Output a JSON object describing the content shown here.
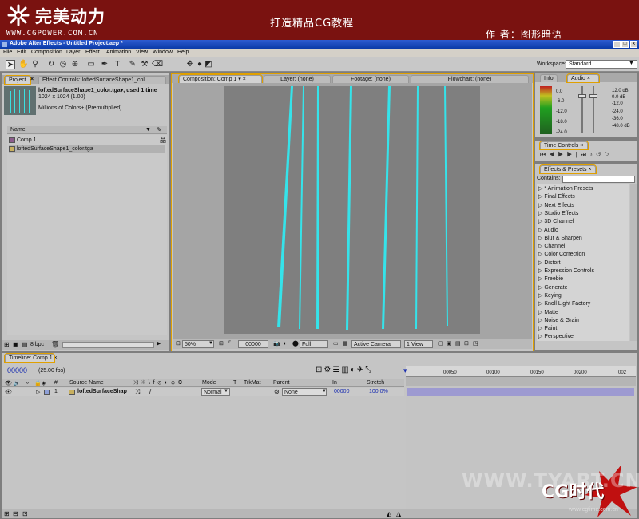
{
  "banner": {
    "logo_text": "完美动力",
    "site_url": "WWW.CGPOWER.COM.CN",
    "title": "打造精品CG教程",
    "author": "作 者：图形暗语",
    "color": "#7a1210"
  },
  "window": {
    "title": "Adobe After Effects - Untitled Project.aep *",
    "buttons": [
      "_",
      "□",
      "x"
    ]
  },
  "menu": [
    "File",
    "Edit",
    "Composition",
    "Layer",
    "Effect",
    "Animation",
    "View",
    "Window",
    "Help"
  ],
  "toolbar": {
    "tools": [
      "selection-tool-icon",
      "hand-tool-icon",
      "zoom-tool-icon",
      "rotation-tool-icon",
      "orbit-camera-icon",
      "pan-behind-icon",
      "mask-tool-icon",
      "pen-tool-icon",
      "type-tool-icon",
      "brush-tool-icon",
      "clone-stamp-icon",
      "eraser-icon"
    ],
    "workspace_label": "Workspace:",
    "workspace_value": "Standard"
  },
  "project": {
    "tabs": [
      "Project",
      "Effect Controls: loftedSurfaceShape1_col"
    ],
    "selected_file": "loftedSurfaceShape1_color.tga▾, used 1 time",
    "dimensions": "1024 x 1024 (1.00)",
    "colors": "Millions of Colors+ (Premultiplied)",
    "name_header": "Name",
    "items": [
      {
        "name": "Comp 1"
      },
      {
        "name": "loftedSurfaceShape1_color.tga"
      }
    ],
    "bpc": "8 bpc"
  },
  "composition": {
    "tabs": [
      "Composition: Comp 1",
      "Layer: (none)",
      "Footage: (none)",
      "Flowchart: (none)"
    ],
    "zoom": "50%",
    "timecode": "00000",
    "resolution": "Full",
    "camera": "Active Camera",
    "views": "1 View",
    "stroke_color": "#35e3ea"
  },
  "info": {
    "tabs": [
      "Info",
      "Audio"
    ],
    "db_left": [
      "0.0",
      "-6.0",
      "-12.0",
      "-18.0",
      "-24.0"
    ],
    "db_right": [
      "12.0 dB",
      "0.0 dB",
      "-12.0",
      "-24.0",
      "-36.0",
      "-48.0 dB"
    ]
  },
  "time_controls": {
    "tab": "Time Controls"
  },
  "effects": {
    "tab": "Effects & Presets",
    "contains_label": "Contains:",
    "items": [
      "* Animation Presets",
      "Final Effects",
      "Next Effects",
      "Studio Effects",
      "3D Channel",
      "Audio",
      "Blur & Sharpen",
      "Channel",
      "Color Correction",
      "Distort",
      "Expression Controls",
      "Freebie",
      "Generate",
      "Keying",
      "Knoll Light Factory",
      "Matte",
      "Noise & Grain",
      "Paint",
      "Perspective"
    ]
  },
  "timeline": {
    "tab": "Timeline: Comp 1",
    "timecode": "00000",
    "fps": "(25.00 fps)",
    "columns": {
      "index": "#",
      "source": "Source Name",
      "mode": "Mode",
      "t": "T",
      "trkmat": "TrkMat",
      "parent": "Parent",
      "in": "In",
      "stretch": "Stretch"
    },
    "ruler": [
      "00050",
      "00100",
      "00150",
      "00200",
      "002"
    ],
    "layer": {
      "index": "1",
      "name": "loftedSurfaceShap",
      "mode": "Normal",
      "parent": "None",
      "in": "00000",
      "stretch": "100.0%"
    }
  },
  "watermark": {
    "text": "WWW.TYART.CN",
    "brand": "CG时代",
    "url": "www.cgtime.com.cn"
  }
}
